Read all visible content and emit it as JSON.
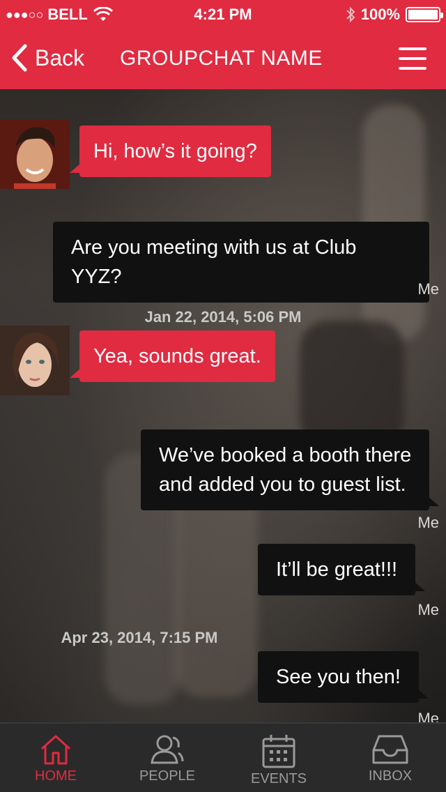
{
  "status": {
    "carrier": "BELL",
    "time": "4:21 PM",
    "battery": "100%"
  },
  "nav": {
    "back_label": "Back",
    "title": "GROUPCHAT NAME"
  },
  "messages": [
    {
      "text": "Hi, how’s it going?"
    },
    {
      "text": "Are you meeting with us at Club YYZ?",
      "sender": "Me"
    },
    {
      "timestamp": "Jan 22, 2014, 5:06 PM"
    },
    {
      "text": "Yea, sounds great."
    },
    {
      "text_line1": "We’ve booked a booth there",
      "text_line2": "and added you to guest list.",
      "sender": "Me"
    },
    {
      "text": "It’ll be great!!!",
      "sender": "Me"
    },
    {
      "timestamp": "Apr 23, 2014, 7:15 PM"
    },
    {
      "text": "See you then!",
      "sender": "Me"
    }
  ],
  "tabs": [
    {
      "label": "HOME",
      "icon": "home-icon",
      "active": true
    },
    {
      "label": "PEOPLE",
      "icon": "people-icon"
    },
    {
      "label": "EVENTS",
      "icon": "calendar-icon"
    },
    {
      "label": "INBOX",
      "icon": "inbox-icon"
    }
  ],
  "colors": {
    "accent": "#e02b41",
    "dark_bubble": "#111111",
    "tabbar": "#2a2a2a"
  }
}
